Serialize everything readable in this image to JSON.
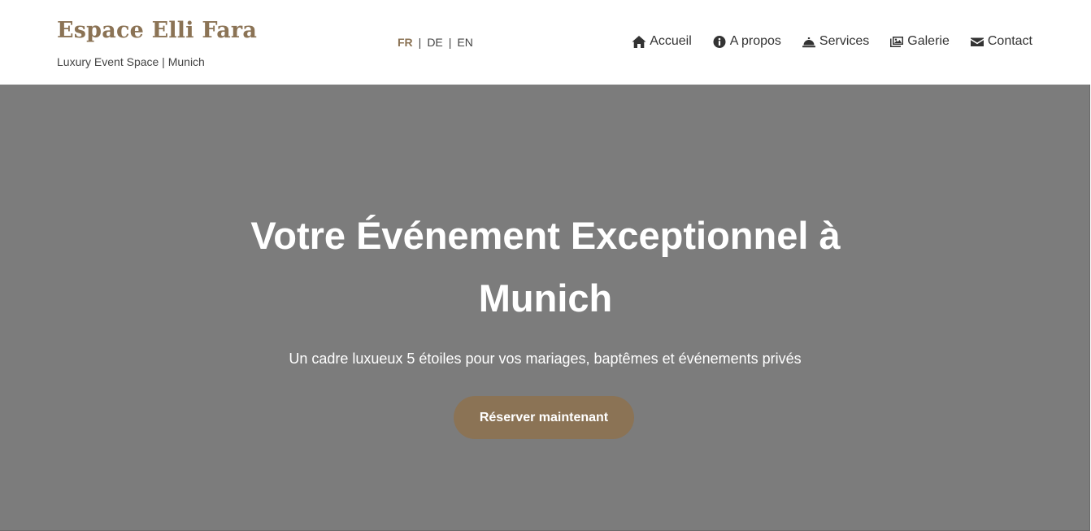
{
  "brand": {
    "title": "Espace Elli Fara",
    "tagline": "Luxury Event Space | Munich"
  },
  "languages": [
    {
      "code": "FR",
      "active": true
    },
    {
      "code": "DE",
      "active": false
    },
    {
      "code": "EN",
      "active": false
    }
  ],
  "lang_separator": "|",
  "nav": [
    {
      "label": "Accueil",
      "icon": "home-icon"
    },
    {
      "label": "A propos",
      "icon": "info-circle-icon"
    },
    {
      "label": "Services",
      "icon": "concierge-bell-icon"
    },
    {
      "label": "Galerie",
      "icon": "images-icon"
    },
    {
      "label": "Contact",
      "icon": "envelope-icon"
    }
  ],
  "hero": {
    "title": "Votre Événement Exceptionnel à Munich",
    "subtitle": "Un cadre luxueux 5 étoiles pour vos mariages, baptêmes et événements privés",
    "cta_label": "Réserver maintenant"
  },
  "colors": {
    "accent": "#8b7355",
    "hero_background": "#7c7c7c",
    "header_background": "#ffffff"
  }
}
